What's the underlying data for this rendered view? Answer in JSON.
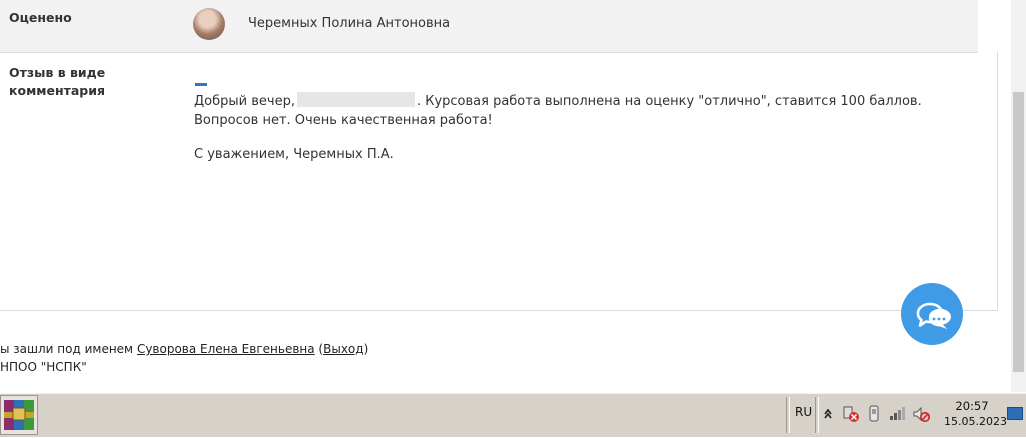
{
  "grading": {
    "graded_label": "Оценено",
    "grader_name": "Черемных Полина Антоновна",
    "feedback_label": "Отзыв в виде комментария",
    "comment_greeting": "Добрый вечер,",
    "comment_rest_line1": ". Курсовая работа выполнена на оценку \"отлично\", ставится 100 баллов.",
    "comment_line2": "Вопросов нет. Очень качественная работа!",
    "comment_signature": "С уважением, Черемных П.А."
  },
  "footer": {
    "logged_in_prefix": "ы зашли под именем",
    "user_name": "Суворова Елена Евгеньевна",
    "logout_open": "(",
    "logout_label": "Выход",
    "logout_close": ")",
    "org_name": "НПОО \"НСПК\""
  },
  "taskbar": {
    "language": "RU",
    "time": "20:57",
    "date": "15.05.2023"
  },
  "icons": {
    "chat": "chat-bubbles-icon",
    "start": "winrar-app-icon",
    "tray": [
      "chevron-up-icon",
      "network-warning-icon",
      "usb-drive-icon",
      "signal-bars-icon",
      "volume-muted-icon"
    ]
  },
  "colors": {
    "accent": "#3f9be6",
    "dash": "#2b78c2",
    "row_bg": "#f2f2f2",
    "taskbar": "#d6d2c9"
  }
}
